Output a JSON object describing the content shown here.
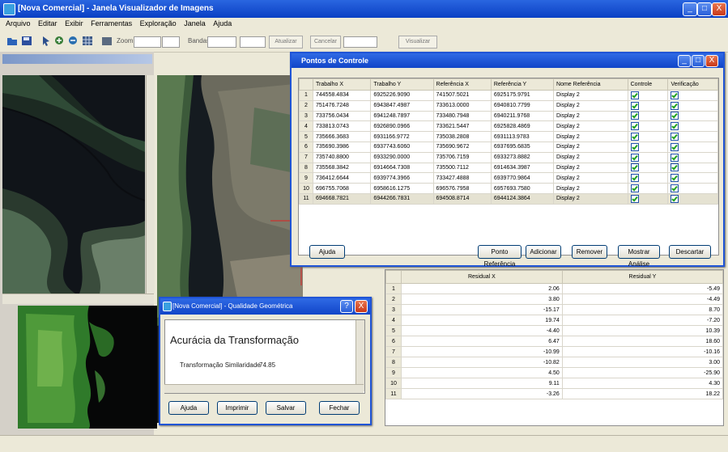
{
  "app": {
    "title": "[Nova Comercial] - Janela Visualizador de Imagens",
    "window_buttons": [
      "_",
      "□",
      "X"
    ]
  },
  "menu": [
    "Arquivo",
    "Editar",
    "Exibir",
    "Ferramentas",
    "Exploração",
    "Janela",
    "Ajuda"
  ],
  "toolbar": {
    "zoom_label": "Zoom",
    "bands_label": "Bandas",
    "btn_a": "Atualizar",
    "btn_b": "Cancelar",
    "btn_c": "Visualizar"
  },
  "gcp_dialog": {
    "title": "Pontos de Controle",
    "columns": [
      "Trabalho X",
      "Trabalho Y",
      "Referência X",
      "Referência Y",
      "Nome Referência",
      "Controle",
      "Verificação"
    ],
    "rows": [
      {
        "n": "1",
        "c": [
          "744558.4834",
          "6925226.9090",
          "741507.5021",
          "6925175.9791",
          "Display 2"
        ]
      },
      {
        "n": "2",
        "c": [
          "751476.7248",
          "6943847.4987",
          "733613.0000",
          "6940810.7799",
          "Display 2"
        ]
      },
      {
        "n": "3",
        "c": [
          "733756.0434",
          "6941248.7897",
          "733480.7948",
          "6940211.9768",
          "Display 2"
        ]
      },
      {
        "n": "4",
        "c": [
          "733813.0743",
          "6926890.0966",
          "733621.5447",
          "6925828.4869",
          "Display 2"
        ]
      },
      {
        "n": "5",
        "c": [
          "735666.3683",
          "6931166.9772",
          "735038.2808",
          "6931113.9783",
          "Display 2"
        ]
      },
      {
        "n": "6",
        "c": [
          "735690.3986",
          "6937743.6060",
          "735690.9672",
          "6937695.6835",
          "Display 2"
        ]
      },
      {
        "n": "7",
        "c": [
          "735740.8800",
          "6933290.0000",
          "735706.7159",
          "6933273.8882",
          "Display 2"
        ]
      },
      {
        "n": "8",
        "c": [
          "735568.3842",
          "6914664.7308",
          "735500.7112",
          "6914634.3987",
          "Display 2"
        ]
      },
      {
        "n": "9",
        "c": [
          "736412.6644",
          "6939774.3966",
          "733427.4888",
          "6939770.9864",
          "Display 2"
        ]
      },
      {
        "n": "10",
        "c": [
          "696755.7068",
          "6958616.1275",
          "696576.7958",
          "6957693.7580",
          "Display 2"
        ]
      },
      {
        "n": "11",
        "c": [
          "694668.7821",
          "6944266.7831",
          "694508.8714",
          "6944124.3864",
          "Display 2"
        ]
      }
    ],
    "buttons": {
      "help": "Ajuda",
      "ref_points": "Ponto Referência",
      "add": "Adicionar",
      "remove": "Remover",
      "analysis": "Mostrar Análise",
      "close": "Descartar"
    }
  },
  "residuals": {
    "columns": [
      "Residual X",
      "Residual Y"
    ],
    "rows": [
      {
        "n": "1",
        "x": "2.06",
        "y": "-5.49"
      },
      {
        "n": "2",
        "x": "3.80",
        "y": "-4.49"
      },
      {
        "n": "3",
        "x": "-15.17",
        "y": "8.70"
      },
      {
        "n": "4",
        "x": "19.74",
        "y": "-7.20"
      },
      {
        "n": "5",
        "x": "-4.40",
        "y": "10.39"
      },
      {
        "n": "6",
        "x": "6.47",
        "y": "18.60"
      },
      {
        "n": "7",
        "x": "-10.99",
        "y": "-10.16"
      },
      {
        "n": "8",
        "x": "-10.82",
        "y": "3.00"
      },
      {
        "n": "9",
        "x": "4.50",
        "y": "-25.90"
      },
      {
        "n": "10",
        "x": "9.11",
        "y": "4.30"
      },
      {
        "n": "11",
        "x": "-3.26",
        "y": "18.22"
      }
    ]
  },
  "quality_dialog": {
    "title": "[Nova Comercial] - Qualidade Geométrica",
    "heading": "Acurácia da Transformação",
    "label": "Transformação Similaridade",
    "value": "74.85",
    "buttons": {
      "help": "Ajuda",
      "print": "Imprimir",
      "save": "Salvar",
      "close": "Fechar"
    }
  },
  "colors": {
    "title_blue": "#0a3fc4",
    "dialog_border": "#1f54d6",
    "window_bg": "#ece9d8",
    "check_green": "#21a121"
  }
}
